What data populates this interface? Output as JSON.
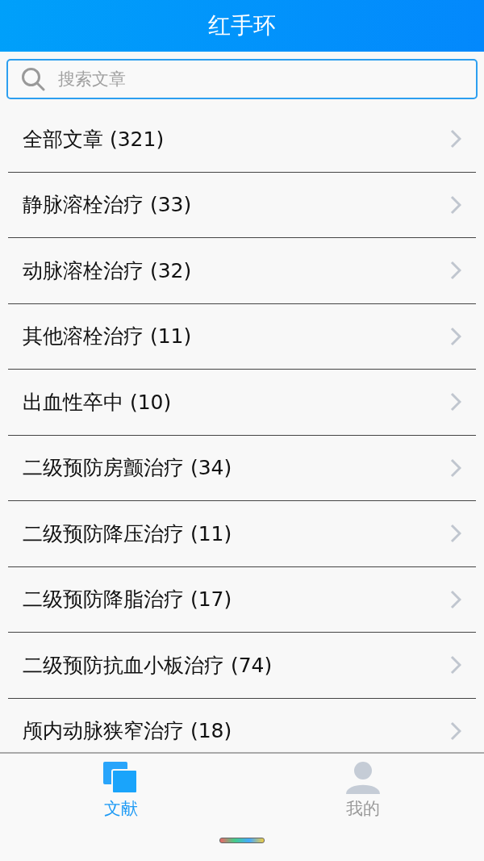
{
  "header": {
    "title": "红手环"
  },
  "search": {
    "placeholder": "搜索文章"
  },
  "categories": [
    {
      "label": "全部文章 (321)"
    },
    {
      "label": "静脉溶栓治疗 (33)"
    },
    {
      "label": "动脉溶栓治疗 (32)"
    },
    {
      "label": "其他溶栓治疗 (11)"
    },
    {
      "label": "出血性卒中 (10)"
    },
    {
      "label": "二级预防房颤治疗 (34)"
    },
    {
      "label": "二级预防降压治疗 (11)"
    },
    {
      "label": "二级预防降脂治疗 (17)"
    },
    {
      "label": "二级预防抗血小板治疗 (74)"
    },
    {
      "label": "颅内动脉狭窄治疗 (18)"
    }
  ],
  "tab_bar": [
    {
      "label": "文献",
      "kind": "documents",
      "selected": true
    },
    {
      "label": "我的",
      "kind": "profile",
      "selected": false
    }
  ]
}
